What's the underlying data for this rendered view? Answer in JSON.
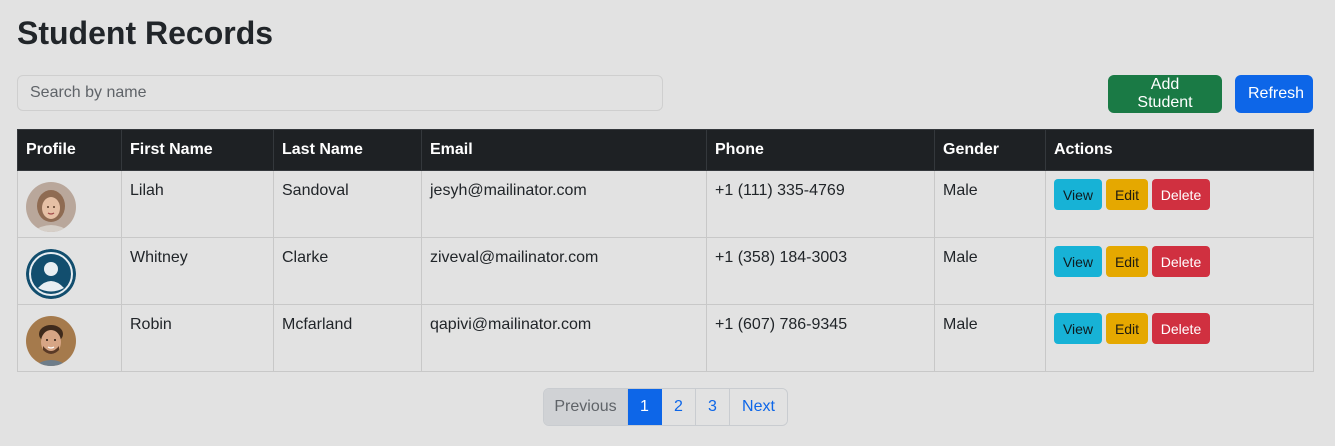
{
  "page": {
    "title": "Student Records"
  },
  "search": {
    "placeholder": "Search by name",
    "value": ""
  },
  "toolbar": {
    "add_label": "Add Student",
    "refresh_label": "Refresh"
  },
  "table": {
    "headers": [
      "Profile",
      "First Name",
      "Last Name",
      "Email",
      "Phone",
      "Gender",
      "Actions"
    ],
    "rows": [
      {
        "avatar": "woman-photo-avatar",
        "first": "Lilah",
        "last": "Sandoval",
        "email": "jesyh@mailinator.com",
        "phone": "+1 (111) 335-4769",
        "gender": "Male"
      },
      {
        "avatar": "default-user-avatar",
        "first": "Whitney",
        "last": "Clarke",
        "email": "ziveval@mailinator.com",
        "phone": "+1 (358) 184-3003",
        "gender": "Male"
      },
      {
        "avatar": "man-photo-avatar",
        "first": "Robin",
        "last": "Mcfarland",
        "email": "qapivi@mailinator.com",
        "phone": "+1 (607) 786-9345",
        "gender": "Male"
      }
    ],
    "actions": {
      "view": "View",
      "edit": "Edit",
      "delete": "Delete"
    }
  },
  "pagination": {
    "previous": "Previous",
    "pages": [
      "1",
      "2",
      "3"
    ],
    "current": "1",
    "next": "Next"
  },
  "colors": {
    "background": "#e2e2e2",
    "header_bg": "#1e2124",
    "add_button": "#1a7a45",
    "refresh_button": "#0d66e8",
    "view_button": "#17b2d6",
    "edit_button": "#e5a800",
    "delete_button": "#d03040"
  }
}
